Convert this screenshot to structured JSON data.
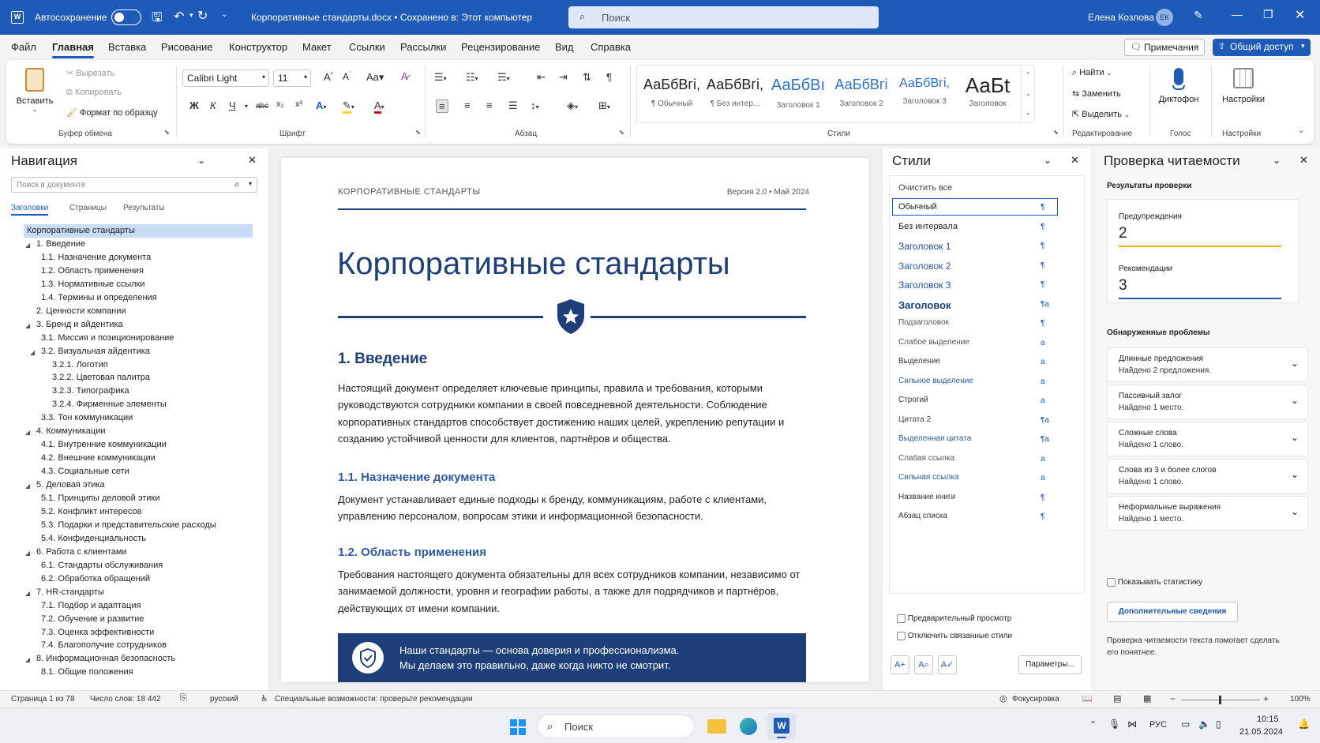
{
  "title": {
    "autosave": "Автосохранение",
    "doc": "Корпоративные стандарты.docx • Сохранено в: Этот компьютер",
    "search": "Поиск",
    "user": "Елена Козлова",
    "initials": "ЕК"
  },
  "menu": [
    "Файл",
    "Главная",
    "Вставка",
    "Рисование",
    "Конструктор",
    "Макет",
    "Ссылки",
    "Рассылки",
    "Рецензирование",
    "Вид",
    "Справка"
  ],
  "menu_right": {
    "notes": "Примечания",
    "share": "Общий доступ"
  },
  "ribbon": {
    "clipboard": {
      "paste": "Вставить",
      "cut": "Вырезать",
      "copy": "Копировать",
      "format": "Формат по образцу",
      "group": "Буфер обмена"
    },
    "font": {
      "name": "Calibri Light",
      "size": "11",
      "group": "Шрифт",
      "bold": "Ж",
      "italic": "К",
      "underline": "Ч",
      "strike": "abc",
      "sub": "x₂",
      "sup": "x²"
    },
    "paragraph": {
      "group": "Абзац"
    },
    "styles": {
      "group": "Стили",
      "items": [
        {
          "preview": "АаБбВгі,",
          "name": "¶ Обычный"
        },
        {
          "preview": "АаБбВгі,",
          "name": "¶ Без интер..."
        },
        {
          "preview": "АаБбВı",
          "name": "Заголовок 1"
        },
        {
          "preview": "АаБбВгі",
          "name": "Заголовок 2"
        },
        {
          "preview": "АаБбВгі,",
          "name": "Заголовок 3"
        },
        {
          "preview": "АаБt",
          "name": "Заголовок"
        }
      ]
    },
    "editing": {
      "find": "Найти",
      "replace": "Заменить",
      "select": "Выделить",
      "group": "Редактирование"
    },
    "voice": {
      "dictate": "Диктофон",
      "group": "Голос"
    },
    "settings": {
      "label": "Настройки",
      "group": "Настройки"
    }
  },
  "nav": {
    "title": "Навигация",
    "search_placeholder": "Поиск в документе",
    "tabs": [
      "Заголовки",
      "Страницы",
      "Результаты"
    ],
    "items": [
      {
        "t": "Корпоративные стандарты",
        "lvl": 0,
        "sel": true
      },
      {
        "t": "1.  Введение",
        "lvl": 1,
        "exp": true
      },
      {
        "t": "1.1.  Назначение документа",
        "lvl": 2
      },
      {
        "t": "1.2.  Область применения",
        "lvl": 2
      },
      {
        "t": "1.3.  Нормативные ссылки",
        "lvl": 2
      },
      {
        "t": "1.4.  Термины и определения",
        "lvl": 2
      },
      {
        "t": "2.  Ценности компании",
        "lvl": 1
      },
      {
        "t": "3.  Бренд и айдентика",
        "lvl": 1,
        "exp": true
      },
      {
        "t": "3.1.  Миссия и позиционирование",
        "lvl": 2
      },
      {
        "t": "3.2.  Визуальная айдентика",
        "lvl": 2,
        "exp": true
      },
      {
        "t": "3.2.1.  Логотип",
        "lvl": 3
      },
      {
        "t": "3.2.2.  Цветовая палитра",
        "lvl": 3
      },
      {
        "t": "3.2.3.  Типографика",
        "lvl": 3
      },
      {
        "t": "3.2.4.  Фирменные элементы",
        "lvl": 3
      },
      {
        "t": "3.3.  Тон коммуникации",
        "lvl": 2
      },
      {
        "t": "4.  Коммуникации",
        "lvl": 1,
        "exp": true
      },
      {
        "t": "4.1.  Внутренние коммуникации",
        "lvl": 2
      },
      {
        "t": "4.2.  Внешние коммуникации",
        "lvl": 2
      },
      {
        "t": "4.3.  Социальные сети",
        "lvl": 2
      },
      {
        "t": "5.  Деловая этика",
        "lvl": 1,
        "exp": true
      },
      {
        "t": "5.1.  Принципы деловой этики",
        "lvl": 2
      },
      {
        "t": "5.2.  Конфликт интересов",
        "lvl": 2
      },
      {
        "t": "5.3.  Подарки и представительские расходы",
        "lvl": 2
      },
      {
        "t": "5.4.  Конфиденциальность",
        "lvl": 2
      },
      {
        "t": "6.  Работа с клиентами",
        "lvl": 1,
        "exp": true
      },
      {
        "t": "6.1.  Стандарты обслуживания",
        "lvl": 2
      },
      {
        "t": "6.2.  Обработка обращений",
        "lvl": 2
      },
      {
        "t": "7.  HR-стандарты",
        "lvl": 1,
        "exp": true
      },
      {
        "t": "7.1.  Подбор и адаптация",
        "lvl": 2
      },
      {
        "t": "7.2.  Обучение и развитие",
        "lvl": 2
      },
      {
        "t": "7.3.  Оценка эффективности",
        "lvl": 2
      },
      {
        "t": "7.4.  Благополучие сотрудников",
        "lvl": 2
      },
      {
        "t": "8.  Информационная безопасность",
        "lvl": 1,
        "exp": true
      },
      {
        "t": "8.1.  Общие положения",
        "lvl": 2
      }
    ]
  },
  "doc": {
    "header_left": "КОРПОРАТИВНЫЕ СТАНДАРТЫ",
    "header_right": "Версия 2.0 • Май 2024",
    "title": "Корпоративные стандарты",
    "h1": "1. Введение",
    "p1": "Настоящий документ определяет ключевые принципы, правила и требования, которыми руководствуются сотрудники компании в своей повседневной деятельности. Соблюдение корпоративных стандартов способствует достижению наших целей, укреплению репутации и созданию устойчивой ценности для клиентов, партнёров и общества.",
    "h11": "1.1. Назначение документа",
    "p2": "Документ устанавливает единые подходы к бренду, коммуникациям, работе с клиентами, управлению персоналом, вопросам этики и информационной безопасности.",
    "h12": "1.2. Область применения",
    "p3": "Требования настоящего документа обязательны для всех сотрудников компании, независимо от занимаемой должности, уровня и географии работы, а также для подрядчиков и партнёров, действующих от имени компании.",
    "banner1": "Наши стандарты — основа доверия и профессионализма.",
    "banner2": "Мы делаем это правильно, даже когда никто не смотрит."
  },
  "styles_pane": {
    "title": "Стили",
    "clear": "Очистить все",
    "items": [
      {
        "t": "Обычный",
        "m": "¶",
        "c": "#222",
        "s": 11,
        "sel": true
      },
      {
        "t": "Без интервала",
        "m": "¶",
        "c": "#222",
        "s": 11
      },
      {
        "t": "Заголовок 1",
        "m": "¶",
        "c": "#1f4e9c",
        "s": 12
      },
      {
        "t": "Заголовок 2",
        "m": "¶",
        "c": "#2b5aa8",
        "s": 12
      },
      {
        "t": "Заголовок 3",
        "m": "¶",
        "c": "#1f4e9c",
        "s": 12
      },
      {
        "t": "Заголовок",
        "m": "¶a",
        "c": "#1f3f7a",
        "s": 13,
        "b": true
      },
      {
        "t": "Подзаголовок",
        "m": "¶",
        "c": "#555",
        "s": 10
      },
      {
        "t": "Слабое выделение",
        "m": "a",
        "c": "#555",
        "s": 10
      },
      {
        "t": "Выделение",
        "m": "a",
        "c": "#333",
        "s": 10
      },
      {
        "t": "Сильное выделение",
        "m": "a",
        "c": "#2b5aa8",
        "s": 10
      },
      {
        "t": "Строгий",
        "m": "a",
        "c": "#333",
        "s": 10
      },
      {
        "t": "Цитата 2",
        "m": "¶a",
        "c": "#444",
        "s": 10
      },
      {
        "t": "Выделенная цитата",
        "m": "¶a",
        "c": "#2b5aa8",
        "s": 10
      },
      {
        "t": "Слабая ссылка",
        "m": "a",
        "c": "#555",
        "s": 10
      },
      {
        "t": "Сильная ссылка",
        "m": "a",
        "c": "#2b5aa8",
        "s": 10
      },
      {
        "t": "Название книги",
        "m": "¶",
        "c": "#333",
        "s": 10
      },
      {
        "t": "Абзац списка",
        "m": "¶",
        "c": "#333",
        "s": 10
      }
    ],
    "preview": "Предварительный просмотр",
    "disable_linked": "Отключить связанные стили",
    "params": "Параметры..."
  },
  "readability": {
    "title": "Проверка читаемости",
    "results": "Результаты проверки",
    "warnings_label": "Предупреждения",
    "warnings": "2",
    "recs_label": "Рекомендации",
    "recs": "3",
    "found": "Обнаруженные проблемы",
    "issues": [
      {
        "t": "Длинные предложения",
        "d": "Найдено 2 предложения."
      },
      {
        "t": "Пассивный залог",
        "d": "Найдено 1 место."
      },
      {
        "t": "Сложные слова",
        "d": "Найдено 1 слово."
      },
      {
        "t": "Слова из 3 и более слогов",
        "d": "Найдено 1 слово."
      },
      {
        "t": "Неформальные выражения",
        "d": "Найдено 1 место."
      }
    ],
    "show_stats": "Показывать статистику",
    "more": "Дополнительные сведения",
    "note": "Проверка читаемости текста помогает сделать его понятнее."
  },
  "status": {
    "page": "Страница 1 из 78",
    "words": "Число слов: 18 442",
    "lang": "русский",
    "access": "Специальные возможности: проверьте рекомендации",
    "focus": "Фокусировка",
    "zoom": "100%"
  },
  "taskbar": {
    "search": "Поиск",
    "lang": "РУС",
    "time": "10:15",
    "date": "21.05.2024"
  },
  "colors": {
    "accent": "#1e5bb8",
    "doc_title": "#1f3f7a",
    "banner": "#1f3f7a",
    "warn_line": "#f2b705",
    "rec_line": "#1e5bb8"
  }
}
